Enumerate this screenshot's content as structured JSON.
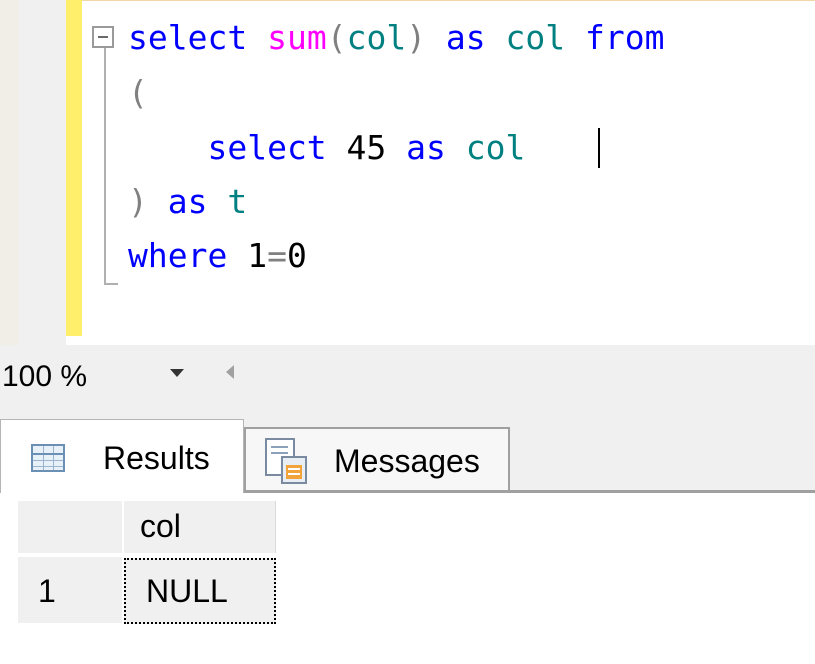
{
  "editor": {
    "lines": [
      [
        {
          "t": "select",
          "c": "kw"
        },
        {
          "t": " ",
          "c": ""
        },
        {
          "t": "sum",
          "c": "fn"
        },
        {
          "t": "(",
          "c": "gray"
        },
        {
          "t": "col",
          "c": "id"
        },
        {
          "t": ")",
          "c": "gray"
        },
        {
          "t": " as ",
          "c": "kw"
        },
        {
          "t": "col",
          "c": "id"
        },
        {
          "t": " from",
          "c": "kw"
        }
      ],
      [
        {
          "t": "(",
          "c": "gray"
        }
      ],
      [
        {
          "t": "    select ",
          "c": "kw"
        },
        {
          "t": "45",
          "c": "num"
        },
        {
          "t": " as ",
          "c": "kw"
        },
        {
          "t": "col",
          "c": "id"
        }
      ],
      [
        {
          "t": ")",
          "c": "gray"
        },
        {
          "t": " as ",
          "c": "kw"
        },
        {
          "t": "t",
          "c": "id"
        }
      ],
      [
        {
          "t": "where ",
          "c": "kw"
        },
        {
          "t": "1",
          "c": "num"
        },
        {
          "t": "=",
          "c": "gray"
        },
        {
          "t": "0",
          "c": "num"
        }
      ]
    ]
  },
  "zoom": {
    "value": "100 %"
  },
  "tabs": {
    "results": "Results",
    "messages": "Messages"
  },
  "grid": {
    "columns": [
      "col"
    ],
    "rows": [
      {
        "row_num": "1",
        "cells": [
          "NULL"
        ]
      }
    ]
  },
  "colors": {
    "keyword": "#0000ff",
    "function": "#ff00ff",
    "operator": "#808080",
    "identifier": "#008080",
    "change_bar": "#ffef6b"
  }
}
